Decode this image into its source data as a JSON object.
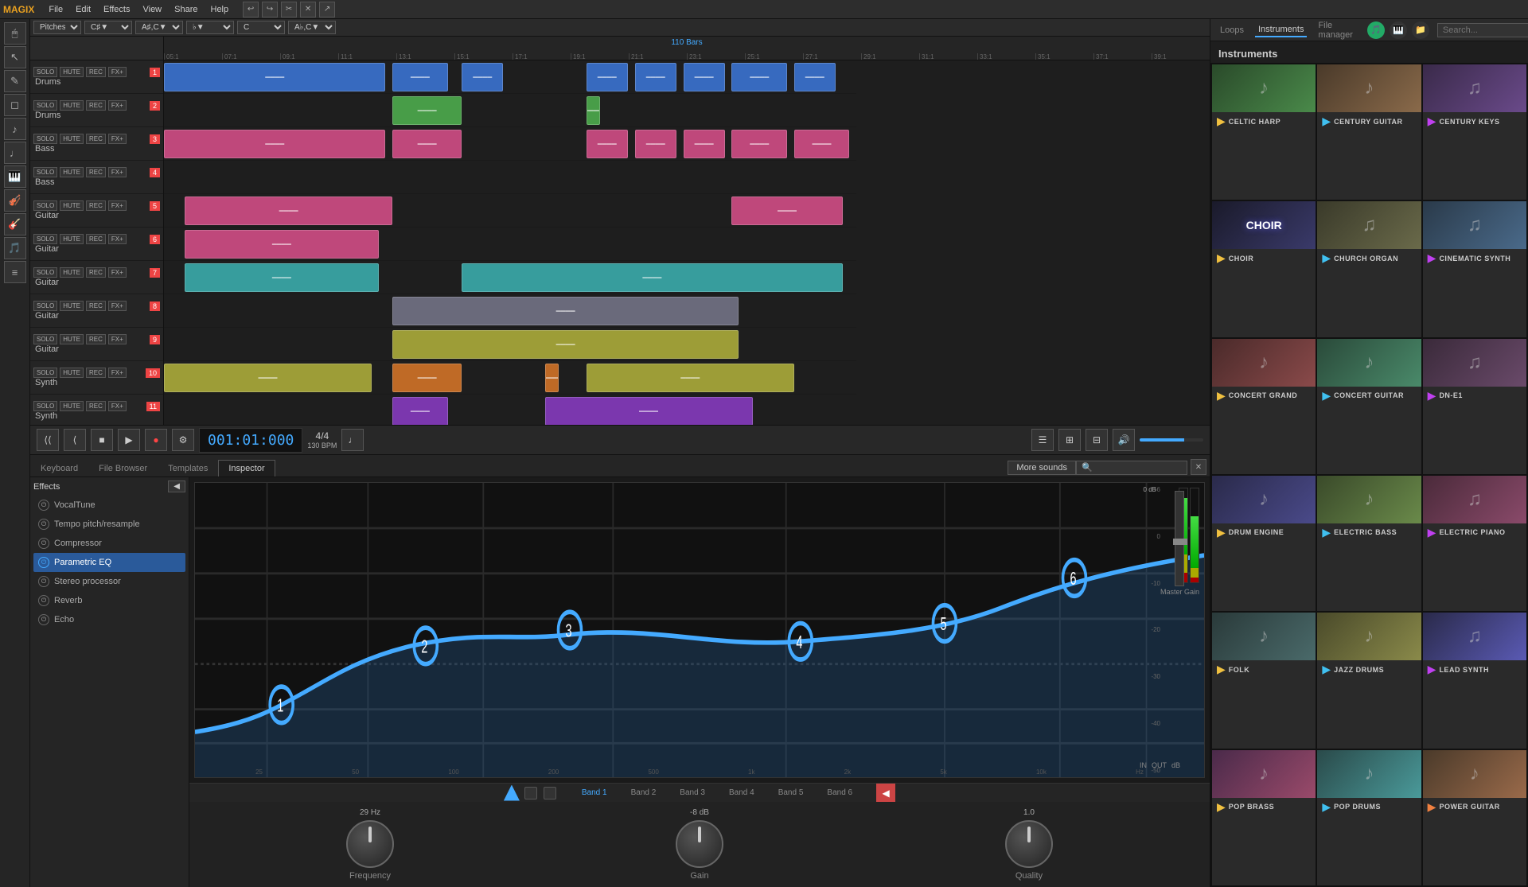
{
  "app": {
    "title": "MAGIX",
    "menu": [
      "File",
      "Edit",
      "Effects",
      "View",
      "Share",
      "Help"
    ],
    "time_display": "001:01:000",
    "bpm": "130 BPM",
    "time_sig": "4/4",
    "bars_label": "110 Bars"
  },
  "tracks": [
    {
      "name": "Drums",
      "number": "1",
      "color": "blue",
      "type": "drums"
    },
    {
      "name": "Drums",
      "number": "2",
      "color": "green",
      "type": "drums"
    },
    {
      "name": "Bass",
      "number": "3",
      "color": "pink",
      "type": "bass"
    },
    {
      "name": "Bass",
      "number": "4",
      "color": "pink",
      "type": "bass"
    },
    {
      "name": "Guitar",
      "number": "5",
      "color": "pink",
      "type": "guitar"
    },
    {
      "name": "Guitar",
      "number": "6",
      "color": "pink",
      "type": "guitar"
    },
    {
      "name": "Guitar",
      "number": "7",
      "color": "teal",
      "type": "guitar"
    },
    {
      "name": "Guitar",
      "number": "8",
      "color": "gray",
      "type": "guitar"
    },
    {
      "name": "Guitar",
      "number": "9",
      "color": "yellow",
      "type": "guitar"
    },
    {
      "name": "Synth",
      "number": "10",
      "color": "yellow",
      "type": "synth"
    },
    {
      "name": "Synth",
      "number": "11",
      "color": "purple",
      "type": "synth"
    }
  ],
  "ruler": [
    "05:1",
    "07:1",
    "09:1",
    "11:1",
    "13:1",
    "15:1",
    "17:1",
    "19:1",
    "21:1",
    "23:1",
    "25:1",
    "27:1",
    "29:1",
    "31:1",
    "33:1",
    "35:1",
    "37:1",
    "39:1"
  ],
  "bottom_tabs": [
    "Keyboard",
    "File Browser",
    "Templates",
    "Inspector"
  ],
  "active_tab": "Inspector",
  "fx_list": [
    {
      "name": "VocalTune",
      "active": false
    },
    {
      "name": "Tempo pitch/resample",
      "active": false
    },
    {
      "name": "Compressor",
      "active": false
    },
    {
      "name": "Parametric EQ",
      "active": true
    },
    {
      "name": "Stereo processor",
      "active": false
    },
    {
      "name": "Reverb",
      "active": false
    },
    {
      "name": "Echo",
      "active": false
    }
  ],
  "eq": {
    "bands": [
      "Band 1",
      "Band 2",
      "Band 3",
      "Band 4",
      "Band 5",
      "Band 6"
    ],
    "active_band": "Band 1",
    "frequency": {
      "value": "29 Hz",
      "label": "Frequency"
    },
    "gain": {
      "value": "-8 dB",
      "label": "Gain"
    },
    "quality": {
      "value": "1.0",
      "label": "Quality"
    },
    "db_scale": [
      "6",
      "0",
      "-10",
      "-20",
      "-30",
      "-40",
      "-50"
    ],
    "freq_labels": [
      "25",
      "50",
      "100",
      "200",
      "500",
      "1k",
      "2k",
      "5k",
      "10k",
      "Hz"
    ],
    "master_gain_label": "Master Gain",
    "0db_label": "0 dB"
  },
  "right_panel": {
    "tabs": [
      "Loops",
      "Instruments",
      "File manager"
    ],
    "active_tab": "Instruments",
    "header": "Instruments",
    "search_placeholder": "Search...",
    "instruments": [
      {
        "name": "CELTIC HARP",
        "icon": "♪",
        "icon_color": "yellow"
      },
      {
        "name": "CENTURY GUITAR",
        "icon": "♪",
        "icon_color": "green"
      },
      {
        "name": "CENTURY KEYS",
        "icon": "♫",
        "icon_color": "purple"
      },
      {
        "name": "CHOIR",
        "icon": "♪",
        "icon_color": "yellow"
      },
      {
        "name": "CHURCH ORGAN",
        "icon": "♫",
        "icon_color": "green"
      },
      {
        "name": "CINEMATIC SYNTH",
        "icon": "♫",
        "icon_color": "purple"
      },
      {
        "name": "CONCERT GRAND",
        "icon": "♪",
        "icon_color": "yellow"
      },
      {
        "name": "CONCERT GUITAR",
        "icon": "♪",
        "icon_color": "green"
      },
      {
        "name": "DN-E1",
        "icon": "♫",
        "icon_color": "purple"
      },
      {
        "name": "DRUM ENGINE",
        "icon": "♪",
        "icon_color": "yellow"
      },
      {
        "name": "ELECTRIC BASS",
        "icon": "♪",
        "icon_color": "green"
      },
      {
        "name": "ELECTRIC PIANO",
        "icon": "♫",
        "icon_color": "purple"
      },
      {
        "name": "FOLK",
        "icon": "♪",
        "icon_color": "yellow"
      },
      {
        "name": "JAZZ DRUMS",
        "icon": "♪",
        "icon_color": "green"
      },
      {
        "name": "LEAD SYNTH",
        "icon": "♫",
        "icon_color": "purple"
      },
      {
        "name": "POP BRASS",
        "icon": "♪",
        "icon_color": "yellow"
      },
      {
        "name": "POP DRUMS",
        "icon": "♪",
        "icon_color": "green"
      },
      {
        "name": "POWER GUITAR",
        "icon": "♪",
        "icon_color": "orange"
      }
    ]
  },
  "transport": {
    "rewind": "⏮",
    "back": "⏪",
    "stop": "⏹",
    "play": "▶",
    "record": "⏺",
    "settings": "⚙"
  },
  "more_sounds": "More sounds"
}
